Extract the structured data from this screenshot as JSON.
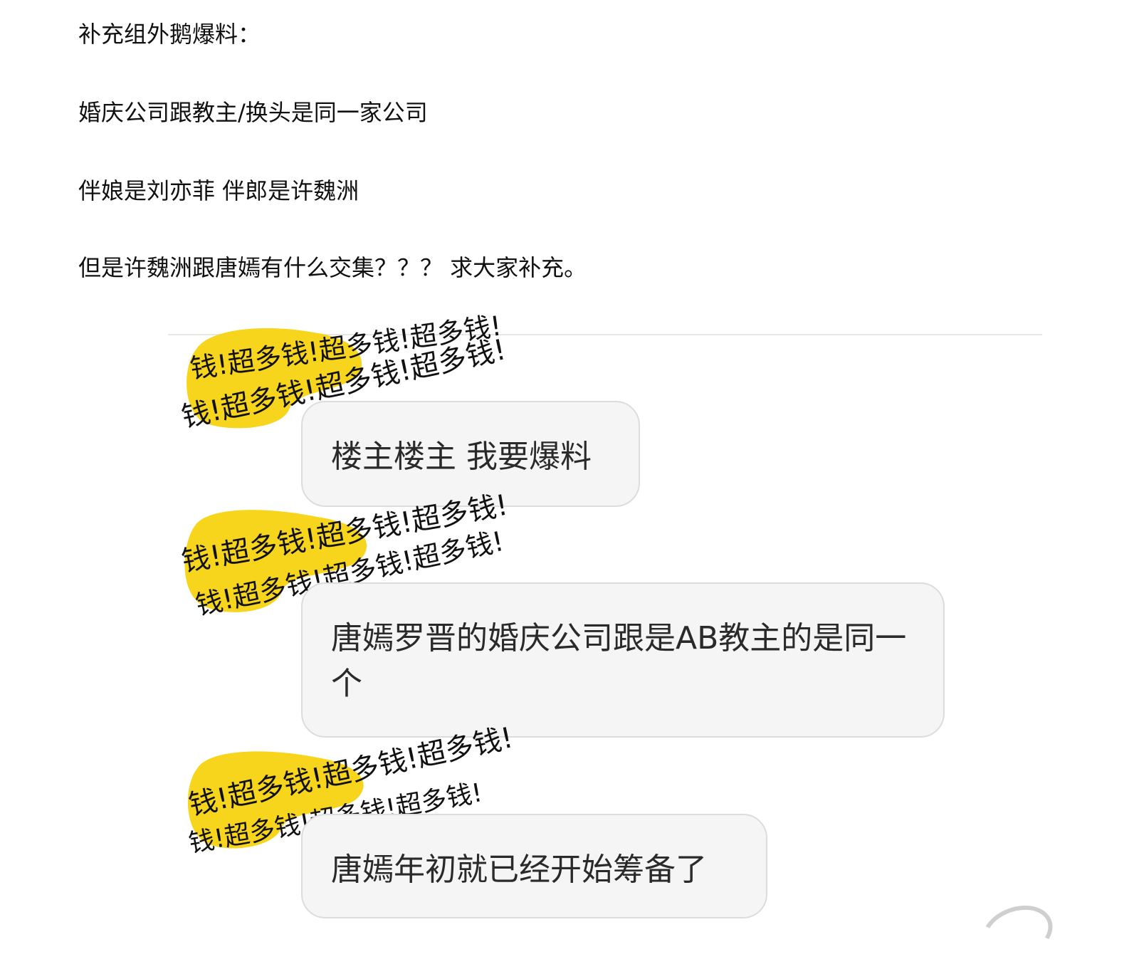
{
  "post": {
    "lines": [
      "补充组外鹅爆料：",
      "婚庆公司跟教主/换头是同一家公司",
      "伴娘是刘亦菲 伴郎是许魏洲",
      "但是许魏洲跟唐嫣有什么交集？？？ 求大家补充。"
    ]
  },
  "chat": {
    "messages": [
      {
        "text": "楼主楼主 我要爆料"
      },
      {
        "text": "唐嫣罗晋的婚庆公司跟是AB教主的是同一个"
      },
      {
        "text": "唐嫣年初就已经开始筹备了"
      }
    ],
    "avatar_text": "钱!超多钱!超多钱!超多钱!",
    "colors": {
      "avatar_yellow": "#f7d51d",
      "bubble_bg": "#f5f5f5",
      "bubble_border": "#dcdcdc"
    },
    "avatar_icon": "scribbled-yellow-avatar-icon"
  }
}
